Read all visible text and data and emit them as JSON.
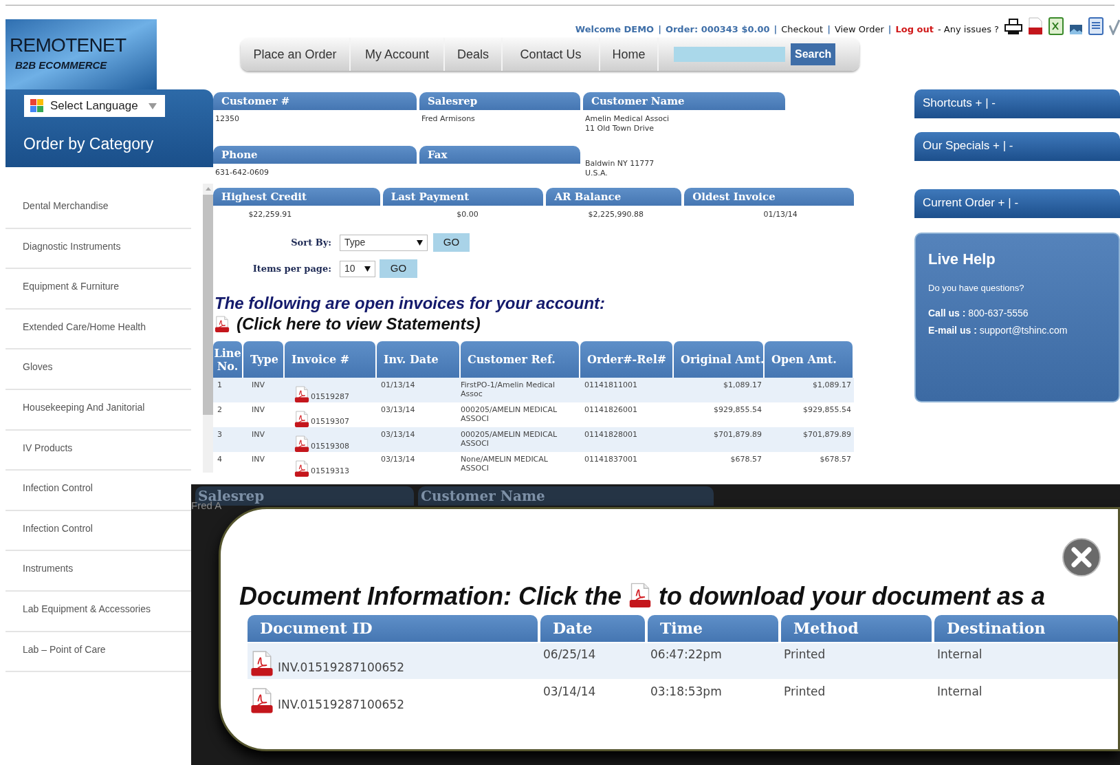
{
  "logo": {
    "title": "REMOTENET",
    "subtitle": "B2B ECOMMERCE"
  },
  "top_links": [
    {
      "text": "Welcome DEMO",
      "kind": "account"
    },
    {
      "text": "|",
      "kind": "separator"
    },
    {
      "text": "Order: 000343 $0.00",
      "kind": "account"
    },
    {
      "text": "|",
      "kind": "separator"
    },
    {
      "text": "Checkout",
      "kind": "link"
    },
    {
      "text": "|",
      "kind": "separator"
    },
    {
      "text": "View Order",
      "kind": "link"
    },
    {
      "text": "|",
      "kind": "separator"
    },
    {
      "text": "Log out",
      "kind": "logout"
    },
    {
      "text": "- Any issues ?",
      "kind": "note"
    }
  ],
  "nav": {
    "tabs": [
      "Place an Order",
      "My Account",
      "Deals",
      "Contact Us",
      "Home"
    ],
    "search_button": "Search"
  },
  "sidebar": {
    "language": "Select Language",
    "title": "Order by Category",
    "items": [
      "Dental Merchandise",
      "Diagnostic Instruments",
      "Equipment & Furniture",
      "Extended Care/Home Health",
      "Gloves",
      "Housekeeping And Janitorial",
      "IV Products",
      "Infection Control",
      "Infection Control",
      "Instruments",
      "Lab Equipment & Accessories",
      "Lab – Point of Care"
    ]
  },
  "account": [
    [
      {
        "label": "Customer #",
        "lines": [
          "12350"
        ]
      },
      {
        "label": "Salesrep",
        "lines": [
          "Fred Armisons"
        ]
      },
      {
        "label": "Customer Name",
        "lines": [
          "Amelin Medical Associ",
          "11 Old Town Drive"
        ]
      }
    ],
    [
      {
        "label": "Phone",
        "lines": [
          "631-642-0609"
        ]
      },
      {
        "label": "Fax"
      },
      {
        "lines": [
          "Baldwin NY 11777",
          "U.S.A."
        ]
      }
    ],
    [
      {
        "label": "Highest Credit",
        "lines": [
          "$22,259.91"
        ]
      },
      {
        "label": "Last Payment",
        "lines": [
          "$0.00"
        ]
      },
      {
        "label": "AR Balance",
        "lines": [
          "$2,225,990.88"
        ]
      },
      {
        "label": "Oldest Invoice",
        "lines": [
          "01/13/14"
        ]
      }
    ]
  ],
  "sort": {
    "label": "Sort By:",
    "value": "Type",
    "button": "GO"
  },
  "per_page": {
    "label": "Items per page:",
    "value": "10",
    "button": "GO"
  },
  "invoices": {
    "heading": "The following are open invoices for your account:",
    "statements_link": "(Click here to view Statements)",
    "columns": [
      "Line No.",
      "Type",
      "Invoice #",
      "Inv. Date",
      "Customer Ref.",
      "Order#-Rel#",
      "Original Amt.",
      "Open Amt."
    ],
    "rows": [
      {
        "line": "1",
        "type": "INV",
        "invoice": "01519287",
        "date": "01/13/14",
        "ref": "FirstPO-1/Amelin Medical Assoc",
        "order": "01141811001",
        "original": "$1,089.17",
        "open": "$1,089.17"
      },
      {
        "line": "2",
        "type": "INV",
        "invoice": "01519307",
        "date": "03/13/14",
        "ref": "000205/AMELIN MEDICAL ASSOCI",
        "order": "01141826001",
        "original": "$929,855.54",
        "open": "$929,855.54"
      },
      {
        "line": "3",
        "type": "INV",
        "invoice": "01519308",
        "date": "03/13/14",
        "ref": "000205/AMELIN MEDICAL ASSOCI",
        "order": "01141828001",
        "original": "$701,879.89",
        "open": "$701,879.89"
      },
      {
        "line": "4",
        "type": "INV",
        "invoice": "01519313",
        "date": "03/13/14",
        "ref": "None/AMELIN MEDICAL ASSOCI",
        "order": "01141837001",
        "original": "$678.57",
        "open": "$678.57"
      }
    ]
  },
  "right_panels": [
    "Shortcuts + | -",
    "Our Specials + | -",
    "Current Order + | -"
  ],
  "live_help": {
    "title": "Live Help",
    "question": "Do you have questions?",
    "lines": [
      "**Call us :** 800-637-5556",
      "**E-mail us :** support@tshinc.com"
    ]
  },
  "backdrop": {
    "headers": [
      "Salesrep",
      "Customer Name"
    ],
    "text": "Fred A"
  },
  "modal": {
    "title_before": "Document Information: Click the",
    "title_after": "to download your document as a",
    "columns": [
      "Document ID",
      "Date",
      "Time",
      "Method",
      "Destination"
    ],
    "rows": [
      {
        "document_id": "INV.01519287100652",
        "date": "06/25/14",
        "time": "06:47:22pm",
        "method": "Printed",
        "destination": "Internal"
      },
      {
        "document_id": "INV.01519287100652",
        "date": "03/14/14",
        "time": "03:18:53pm",
        "method": "Printed",
        "destination": "Internal"
      }
    ]
  }
}
